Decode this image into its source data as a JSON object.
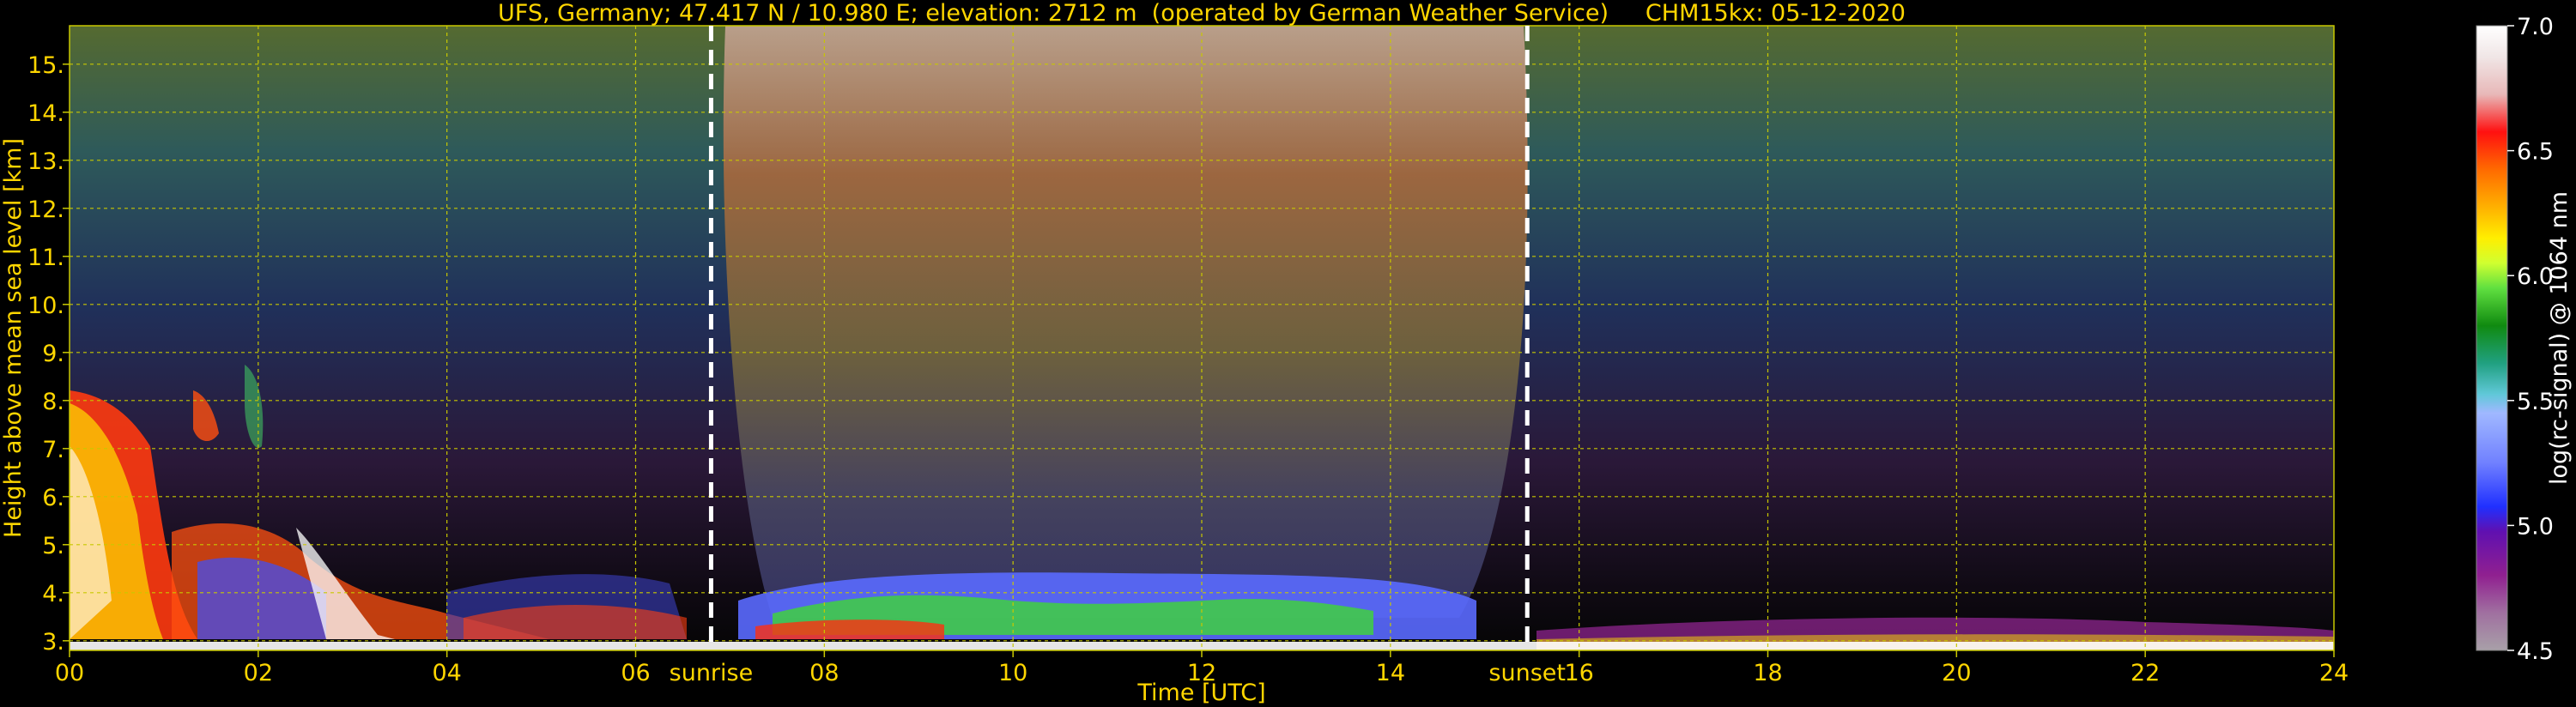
{
  "chart_data": {
    "type": "heatmap",
    "title": "UFS, Germany; 47.417 N / 10.980 E; elevation: 2712 m  (operated by German Weather Service)     CHM15kx: 05-12-2020",
    "xlabel": "Time [UTC]",
    "ylabel": "Height above mean sea level [km]",
    "xlim": [
      0,
      24
    ],
    "ylim": [
      2.8,
      15.8
    ],
    "x_ticks": [
      "00",
      "02",
      "04",
      "06",
      "08",
      "10",
      "12",
      "14",
      "16",
      "18",
      "20",
      "22",
      "24"
    ],
    "y_ticks": [
      "3.",
      "4.",
      "5.",
      "6.",
      "7.",
      "8.",
      "9.",
      "10.",
      "11.",
      "12.",
      "13.",
      "14.",
      "15."
    ],
    "grid": true,
    "events": [
      {
        "label": "sunrise",
        "time": 6.8
      },
      {
        "label": "sunset",
        "time": 15.45
      }
    ],
    "colorbar": {
      "label": "log(rc-signal) @ 1064 nm",
      "ticks": [
        "4.5",
        "5.0",
        "5.5",
        "6.0",
        "6.5",
        "7.0"
      ],
      "range": [
        4.5,
        7.0
      ]
    },
    "colors": {
      "text": "#ffd600",
      "grid": "#c8c800",
      "event_line": "#ffffff"
    }
  }
}
